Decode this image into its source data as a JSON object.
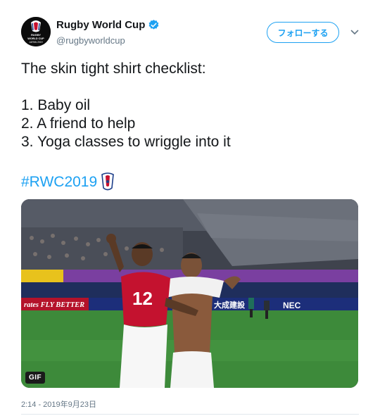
{
  "author": {
    "name": "Rugby World Cup",
    "handle": "@rugbyworldcup",
    "verified": true,
    "avatar_text": [
      "RUGBY",
      "WORLD CUP",
      "JAPAN 2019"
    ]
  },
  "follow_label": "フォローする",
  "tweet": {
    "lines": [
      "The skin tight shirt checklist:",
      "",
      "1. Baby oil",
      "2. A friend to help",
      "3. Yoga classes to wriggle into it"
    ],
    "hashtag": "#RWC2019"
  },
  "media": {
    "badge": "GIF",
    "signage": {
      "left_board": "rates FLY BETTER",
      "center_board": "大成建設",
      "right_board": "NEC",
      "jersey_number": "12"
    }
  },
  "timestamp": "2:14 - 2019年9月23日",
  "colors": {
    "brand": "#1da1f2",
    "handle_gray": "#657786",
    "text": "#14171a",
    "pitch_green": "#3d8a3a"
  },
  "icons": [
    "verified-badge-icon",
    "chevron-down-icon",
    "rwc-emoji-icon"
  ]
}
